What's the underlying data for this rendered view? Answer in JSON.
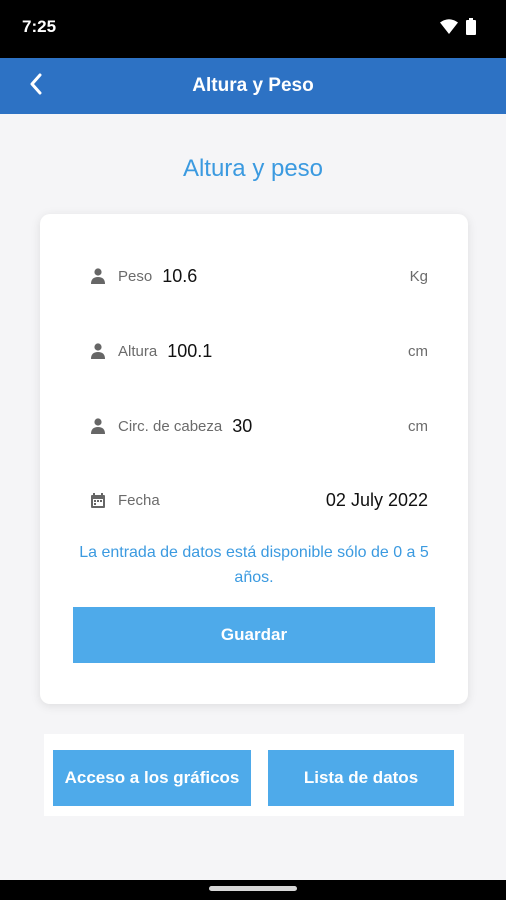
{
  "status_bar": {
    "time": "7:25"
  },
  "app_bar": {
    "title": "Altura y Peso"
  },
  "page": {
    "heading": "Altura y peso"
  },
  "form": {
    "peso": {
      "label": "Peso",
      "value": "10.6",
      "unit": "Kg"
    },
    "altura": {
      "label": "Altura",
      "value": "100.1",
      "unit": "cm"
    },
    "cabeza": {
      "label": "Circ. de cabeza",
      "value": "30",
      "unit": "cm"
    },
    "fecha": {
      "label": "Fecha",
      "value": "02 July 2022"
    },
    "info": "La entrada de datos está disponible sólo de 0 a 5 años.",
    "save_label": "Guardar"
  },
  "bottom": {
    "charts_label": "Acceso a los gráficos",
    "list_label": "Lista de datos"
  },
  "colors": {
    "app_bar": "#2d72c4",
    "accent_text": "#3b9ae0",
    "button": "#4eaaea"
  }
}
